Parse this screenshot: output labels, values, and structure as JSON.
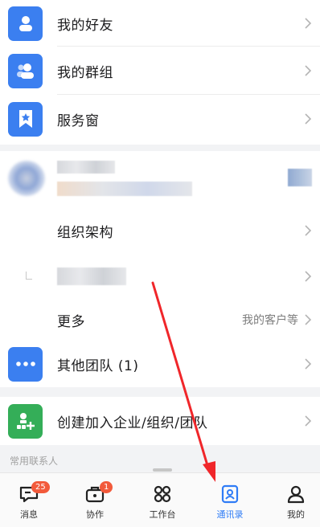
{
  "menu": {
    "friends": "我的好友",
    "groups": "我的群组",
    "service": "服务窗"
  },
  "org": {
    "structure": "组织架构",
    "more": "更多",
    "more_hint": "我的客户等",
    "other_teams": "其他团队 (1)"
  },
  "create": {
    "label": "创建加入企业/组织/团队"
  },
  "section_caption": "常用联系人",
  "tabs": [
    {
      "label": "消息",
      "badge": "25"
    },
    {
      "label": "协作",
      "badge": "1"
    },
    {
      "label": "工作台"
    },
    {
      "label": "通讯录"
    },
    {
      "label": "我的"
    }
  ],
  "colors": {
    "accent": "#3b7ff0",
    "create_green": "#34ae58",
    "badge_red": "#f25a3b",
    "annotation_arrow": "#f0262a"
  }
}
